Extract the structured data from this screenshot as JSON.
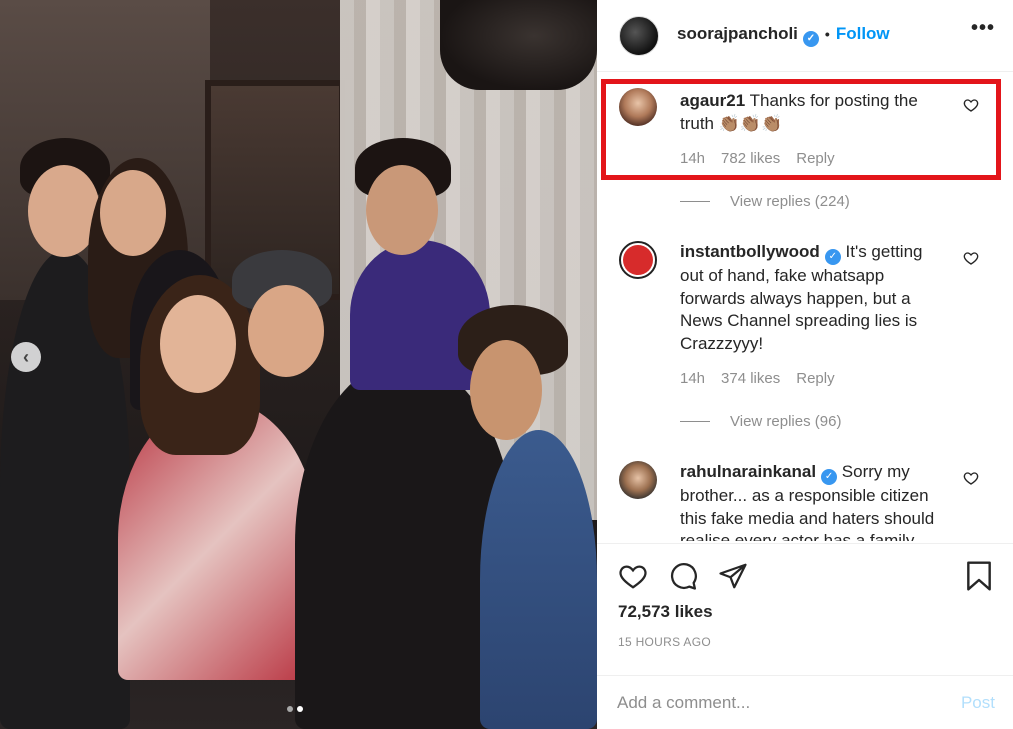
{
  "post": {
    "username": "soorajpancholi",
    "separator": "•",
    "follow_label": "Follow",
    "more_label": "•••",
    "carousel_prev": "‹"
  },
  "comments": [
    {
      "username": "agaur21",
      "text": "Thanks for posting the truth",
      "emoji": "👏🏽👏🏽👏🏽",
      "time": "14h",
      "likes": "782 likes",
      "reply": "Reply",
      "view_replies": "View replies (224)",
      "verified": false
    },
    {
      "username": "instantbollywood",
      "text": "It's getting out of hand, fake whatsapp forwards always happen, but a News Channel spreading lies is Crazzzyyy!",
      "time": "14h",
      "likes": "374 likes",
      "reply": "Reply",
      "view_replies": "View replies (96)",
      "verified": true
    },
    {
      "username": "rahulnarainkanal",
      "text": "Sorry my brother... as a responsible citizen this fake media and haters should realise every actor has a family",
      "verified": true
    }
  ],
  "engagement": {
    "likes": "72,573 likes",
    "timestamp": "15 HOURS AGO"
  },
  "comment_box": {
    "placeholder": "Add a comment...",
    "post_label": "Post"
  },
  "colors": {
    "accent": "#0095f6",
    "highlight": "#e3151a",
    "verified": "#3897f0",
    "muted": "#8e8e8e"
  },
  "icons": [
    "carousel-prev-icon",
    "verified-badge-icon",
    "more-options-icon",
    "heart-icon",
    "comment-icon",
    "share-icon",
    "bookmark-icon"
  ]
}
